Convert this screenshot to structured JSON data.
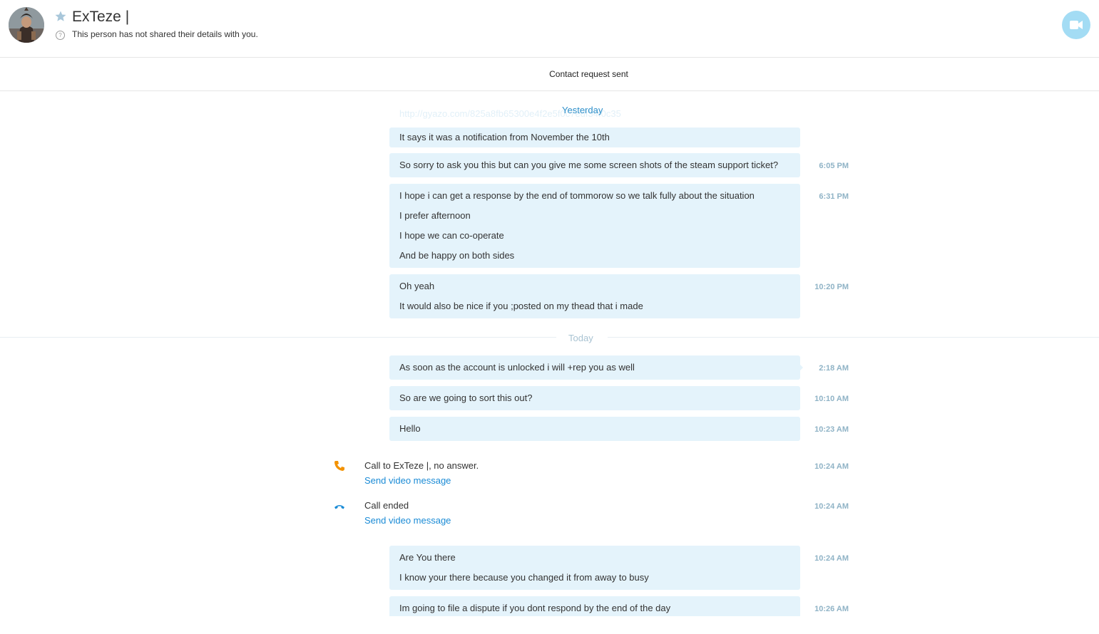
{
  "header": {
    "contact_name": "ExTeze |",
    "details_text": "This person has not shared their details with you.",
    "help_glyph": "?"
  },
  "banner": {
    "text": "Contact request sent"
  },
  "faded_link": "http://gyazo.com/825a8fb65300e4f2e5f0c7edf34f0c35",
  "days": {
    "yesterday": "Yesterday",
    "today": "Today"
  },
  "messages": [
    {
      "lines": [
        "It says it was a notification from November the 10th"
      ],
      "time": ""
    },
    {
      "lines": [
        "So sorry to ask you this but can you give me some screen shots of the steam support ticket?"
      ],
      "time": "6:05 PM"
    },
    {
      "lines": [
        "I hope i can get a response by the end of tommorow so we talk fully about the situation",
        "I prefer afternoon",
        "I hope we can co-operate",
        "And be happy on both sides"
      ],
      "time": "6:31 PM"
    },
    {
      "lines": [
        "Oh yeah",
        "It would also be nice if you ;posted on my thead that i made"
      ],
      "time": "10:20 PM"
    },
    {
      "lines": [
        "As soon as the account is unlocked i will +rep you as well"
      ],
      "time": "2:18 AM"
    },
    {
      "lines": [
        "So are we going to sort this out?"
      ],
      "time": "10:10 AM"
    },
    {
      "lines": [
        "Hello"
      ],
      "time": "10:23 AM"
    },
    {
      "lines": [
        "Are You there",
        "I know your there because you changed it from away to busy"
      ],
      "time": "10:24 AM"
    },
    {
      "lines": [
        "Im going to file a dispute if you dont respond by the end of the day"
      ],
      "time": "10:26 AM"
    }
  ],
  "calls": [
    {
      "text": "Call to ExTeze |, no answer.",
      "link": "Send video message",
      "time": "10:24 AM",
      "icon": "phone-outgoing-icon"
    },
    {
      "text": "Call ended",
      "link": "Send video message",
      "time": "10:24 AM",
      "icon": "phone-hangup-icon"
    }
  ],
  "colors": {
    "accent": "#1a8bd6",
    "bubble": "#e4f3fb",
    "video_button": "#a3dcf4",
    "missed_call": "#f39200"
  }
}
